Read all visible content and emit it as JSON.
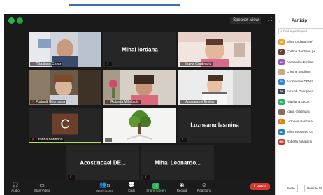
{
  "meeting": {
    "speaker_view_label": "Speaker View"
  },
  "tiles": [
    {
      "name": "Răpăianu Cezar",
      "kind": "video"
    },
    {
      "name": "Mihai Iordana",
      "kind": "name-only"
    },
    {
      "name": "Ioana Gradinariu",
      "kind": "video"
    },
    {
      "name": "Furtună Georgiana",
      "kind": "video"
    },
    {
      "name": "Roberta Mihalachi",
      "kind": "video"
    },
    {
      "name": "Acasandrei Emilian",
      "kind": "video"
    },
    {
      "name": "Cristina Bordianu",
      "kind": "avatar",
      "avatar_letter": "C"
    },
    {
      "name": "",
      "kind": "image"
    },
    {
      "name": "Lozneanu Iasmina",
      "kind": "name-only"
    },
    {
      "name": "Acostinoaei DE...",
      "kind": "name-only"
    },
    {
      "name": "Mihai Leonardo...",
      "kind": "name-only"
    }
  ],
  "toolbar": {
    "audio": "Audio",
    "video": "Start Video",
    "participants": "Participants",
    "participants_count": "11",
    "chat": "Chat",
    "share": "Share Screen",
    "record": "Record",
    "reactions": "Reactions",
    "leave": "Leave"
  },
  "panel": {
    "title": "Particip",
    "search_placeholder": "Find a participant",
    "participants": [
      {
        "initials": "MI",
        "color": "#f0a030",
        "name": "Mihai Iordana (Me)"
      },
      {
        "initials": "C",
        "color": "#6b3f2a",
        "name": "Cristina Bordianu (H"
      },
      {
        "initials": "AE",
        "color": "#9b59b6",
        "name": "Acasandrei Emilian"
      },
      {
        "initials": "",
        "color": "#c9a87c",
        "name": "Cristina Bordianu"
      },
      {
        "initials": "AD",
        "color": "#2e86de",
        "name": "Acostinoaei DENIS"
      },
      {
        "initials": "FG",
        "color": "#34495e",
        "name": "Furtună Georgiana"
      },
      {
        "initials": "RC",
        "color": "#27ae60",
        "name": "Răpăianu Cezar"
      },
      {
        "initials": "",
        "color": "#8e6c5a",
        "name": "Ioana Gradinariu"
      },
      {
        "initials": "LI",
        "color": "#e67e22",
        "name": "Lozneanu Iasmina"
      },
      {
        "initials": "ML",
        "color": "#2980b9",
        "name": "Mihai Leonardo Co"
      },
      {
        "initials": "RM",
        "color": "#c0392b",
        "name": "Roberta Mihalachi"
      }
    ],
    "invite_label": "Invite",
    "unmute_label": "Unmute M"
  }
}
